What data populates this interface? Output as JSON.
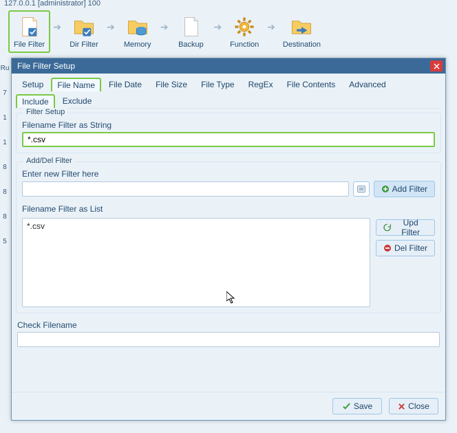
{
  "top_info": "127.0.0.1 [administrator]        100",
  "toolbar": {
    "items": [
      {
        "label": "File Filter",
        "highlighted": true,
        "icon": "file-check"
      },
      {
        "label": "Dir Filter",
        "highlighted": false,
        "icon": "folder-check"
      },
      {
        "label": "Memory",
        "highlighted": false,
        "icon": "folder-db"
      },
      {
        "label": "Backup",
        "highlighted": false,
        "icon": "file"
      },
      {
        "label": "Function",
        "highlighted": false,
        "icon": "gear"
      },
      {
        "label": "Destination",
        "highlighted": false,
        "icon": "folder-arrow"
      }
    ]
  },
  "left_numbers": [
    "Ru",
    "7",
    "1",
    "1",
    "8",
    "8",
    "8",
    "5"
  ],
  "dialog": {
    "title": "File Filter Setup",
    "tabs": [
      "Setup",
      "File Name",
      "File Date",
      "File Size",
      "File Type",
      "RegEx",
      "File Contents",
      "Advanced"
    ],
    "active_tab": 1,
    "subtabs": [
      "Include",
      "Exclude"
    ],
    "active_subtab": 0,
    "filter_setup": {
      "legend": "Filter Setup",
      "string_label": "Filename Filter as String",
      "string_value": "*.csv"
    },
    "add_del": {
      "legend": "Add/Del Filter",
      "new_label": "Enter new Filter here",
      "new_value": "",
      "add_btn": "Add Filter",
      "list_label": "Filename Filter as List",
      "list_items": [
        "*.csv"
      ],
      "upd_btn": "Upd Filter",
      "del_btn": "Del Filter"
    },
    "check": {
      "label": "Check Filename",
      "value": ""
    },
    "footer": {
      "save": "Save",
      "close": "Close"
    }
  }
}
